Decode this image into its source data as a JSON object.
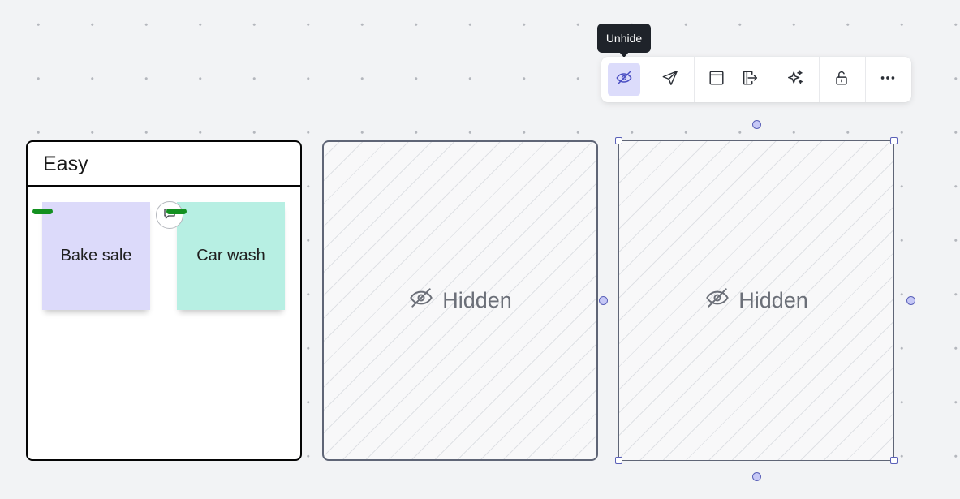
{
  "tooltip": {
    "text": "Unhide"
  },
  "toolbar": {
    "buttons": [
      {
        "icon": "eye-off-icon",
        "label": "Unhide",
        "active": true
      },
      {
        "icon": "send-icon"
      },
      {
        "icon": "frame-icon"
      },
      {
        "icon": "export-icon"
      },
      {
        "icon": "sparkle-icon"
      },
      {
        "icon": "lock-open-icon"
      },
      {
        "icon": "more-icon"
      }
    ]
  },
  "frames": [
    {
      "title": "Easy",
      "hidden": false,
      "stickies": [
        {
          "text": "Bake sale",
          "color": "#dcdafa"
        },
        {
          "text": "Car wash",
          "color": "#b7efe3"
        }
      ]
    },
    {
      "hidden": true,
      "label": "Hidden",
      "selected": false
    },
    {
      "hidden": true,
      "label": "Hidden",
      "selected": true
    }
  ],
  "colors": {
    "canvas": "#f2f3f5",
    "selection": "#5a60b8",
    "active_button": "#dcdcfb",
    "reaction_pill": "#139020"
  }
}
